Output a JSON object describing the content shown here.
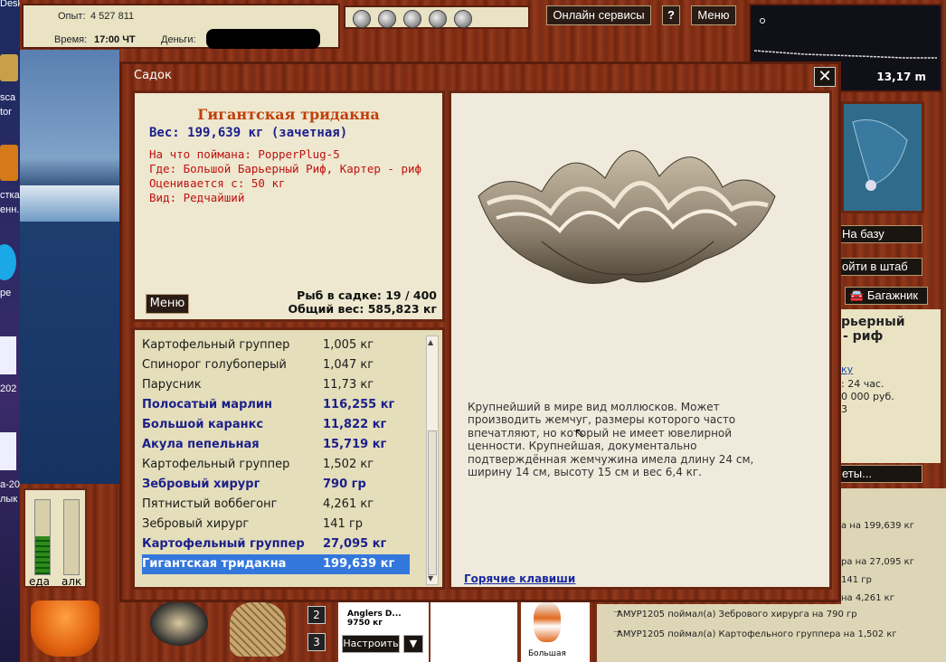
{
  "desktop": {
    "labels": [
      "Desk",
      "sca",
      "tor",
      "стка",
      "енн.",
      "pe",
      "202",
      "a-20",
      "лык"
    ]
  },
  "top": {
    "exp_label": "Опыт:",
    "exp_value": "4 527 811",
    "time_label": "Время:",
    "time_value": "17:00 ЧТ",
    "money_label": "Деньги:",
    "online_label": "Онлайн сервисы",
    "help_label": "?",
    "menu_label": "Меню"
  },
  "depth": {
    "value": "13,17 m"
  },
  "side": {
    "base_label": "На базу",
    "hq_label": "ойти в штаб",
    "trunk_label": "Багажник",
    "loc_title_1": "рьерный",
    "loc_title_2": "- риф",
    "loc_link": "ку",
    "loc_line1": ": 24 час.",
    "loc_line2": "0 000 руб.",
    "loc_line3": "3",
    "tickets_label": "еты..."
  },
  "chat": {
    "lines": [
      "а на 199,639 кг",
      "ра на 27,095 кг",
      "141 гр",
      "на 4,261 кг",
      "АМУР1205 поймал(а) Зебрового хирурга на 790 гр",
      "АМУР1205 поймал(а) Картофельного группера на 1,502 кг"
    ]
  },
  "bottom": {
    "food_label": "еда",
    "alc_label": "алк",
    "slot2": "2",
    "slot3": "3",
    "reel_name": "Anglers D...",
    "reel_weight": "9750 кг",
    "setup_label": "Настроить",
    "bait_caption": "Большая"
  },
  "dialog": {
    "title": "Садок",
    "close": "✕",
    "fish_name": "Гигантская тридакна",
    "weight_line": "Вес: 199,639 кг (зачетная)",
    "caught_with": "На что поймана: PopperPlug-5",
    "where": "Где: Большой Барьерный Риф, Картер - риф",
    "value": "Оценивается с: 50 кг",
    "kind": "Вид: Редчайший",
    "menu_btn": "Меню",
    "count_line": "Рыб в садке: 19 / 400",
    "total_line": "Общий вес: 585,823 кг",
    "description": "Крупнейший в мире вид моллюсков. Может производить жемчуг, размеры которого часто впечатляют, но который не имеет ювелирной ценности. Крупнейшая, документально подтверждённая жемчужина имела длину 24 см, ширину 14 см, высоту 15 см и вес 6,4 кг.",
    "hotkeys": "Горячие клавиши",
    "fish_list": [
      {
        "name": "Картофельный группер",
        "weight": "1,005 кг",
        "bold": false
      },
      {
        "name": "Спинорог голубоперый",
        "weight": "1,047 кг",
        "bold": false
      },
      {
        "name": "Парусник",
        "weight": "11,73 кг",
        "bold": false
      },
      {
        "name": "Полосатый марлин",
        "weight": "116,255 кг",
        "bold": true
      },
      {
        "name": "Большой каранкс",
        "weight": "11,822 кг",
        "bold": true
      },
      {
        "name": "Акула пепельная",
        "weight": "15,719 кг",
        "bold": true
      },
      {
        "name": "Картофельный группер",
        "weight": "1,502 кг",
        "bold": false
      },
      {
        "name": "Зебровый хирург",
        "weight": "790 гр",
        "bold": true
      },
      {
        "name": "Пятнистый воббегонг",
        "weight": "4,261 кг",
        "bold": false
      },
      {
        "name": "Зебровый хирург",
        "weight": "141 гр",
        "bold": false
      },
      {
        "name": "Картофельный группер",
        "weight": "27,095 кг",
        "bold": true
      },
      {
        "name": "Гигантская тридакна",
        "weight": "199,639 кг",
        "bold": true,
        "selected": true
      }
    ]
  },
  "colors": {
    "title_red": "#c0400c",
    "info_red": "#c01010",
    "weight_blue": "#1b1f8a",
    "selected_bg": "#3377dd"
  }
}
